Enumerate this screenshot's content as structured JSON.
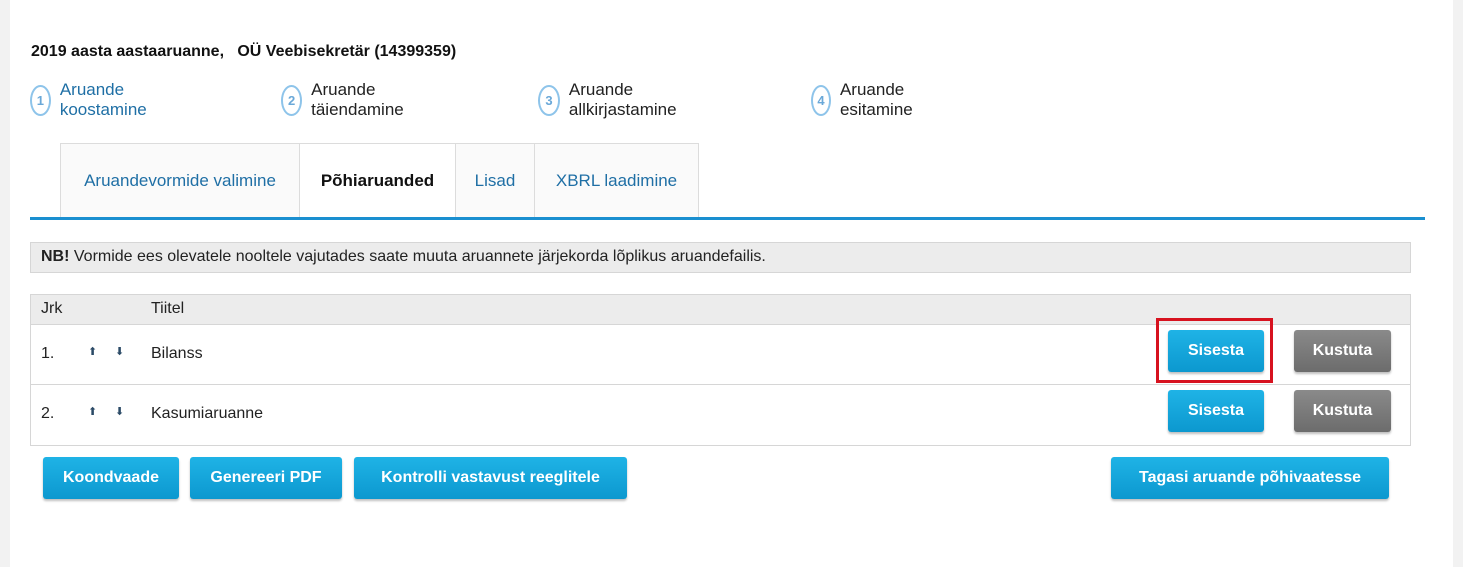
{
  "report": {
    "title": "2019 aasta aastaaruanne,   OÜ Veebisekretär (14399359)"
  },
  "steps": [
    {
      "number": "1",
      "label": "Aruande koostamine"
    },
    {
      "number": "2",
      "label": "Aruande täiendamine"
    },
    {
      "number": "3",
      "label": "Aruande allkirjastamine"
    },
    {
      "number": "4",
      "label": "Aruande esitamine"
    }
  ],
  "tabs": [
    {
      "label": "Aruandevormide valimine"
    },
    {
      "label": "Põhiaruanded"
    },
    {
      "label": "Lisad"
    },
    {
      "label": "XBRL laadimine"
    }
  ],
  "notice": {
    "prefix": "NB!",
    "text": " Vormide ees olevatele nooltele vajutades saate muuta aruannete järjekorda lõplikus aruandefailis."
  },
  "table": {
    "headers": {
      "order": "Jrk",
      "title": "Tiitel"
    },
    "rows": [
      {
        "order": "1.",
        "title": "Bilanss",
        "enter_label": "Sisesta",
        "delete_label": "Kustuta"
      },
      {
        "order": "2.",
        "title": "Kasumiaruanne",
        "enter_label": "Sisesta",
        "delete_label": "Kustuta"
      }
    ]
  },
  "icons": {
    "move_up": "arrow-up-icon",
    "move_down": "arrow-down-icon",
    "up_glyph": "⬆",
    "down_glyph": "⬇"
  },
  "actions": {
    "summary": "Koondvaade",
    "generate_pdf": "Genereeri PDF",
    "check_rules": "Kontrolli vastavust reeglitele",
    "back": "Tagasi aruande põhivaatesse"
  },
  "colors": {
    "primary_button": "#0c98cf",
    "secondary_button": "#6c6c6c",
    "accent_line": "#1a8fd0",
    "highlight": "#d7121f"
  }
}
